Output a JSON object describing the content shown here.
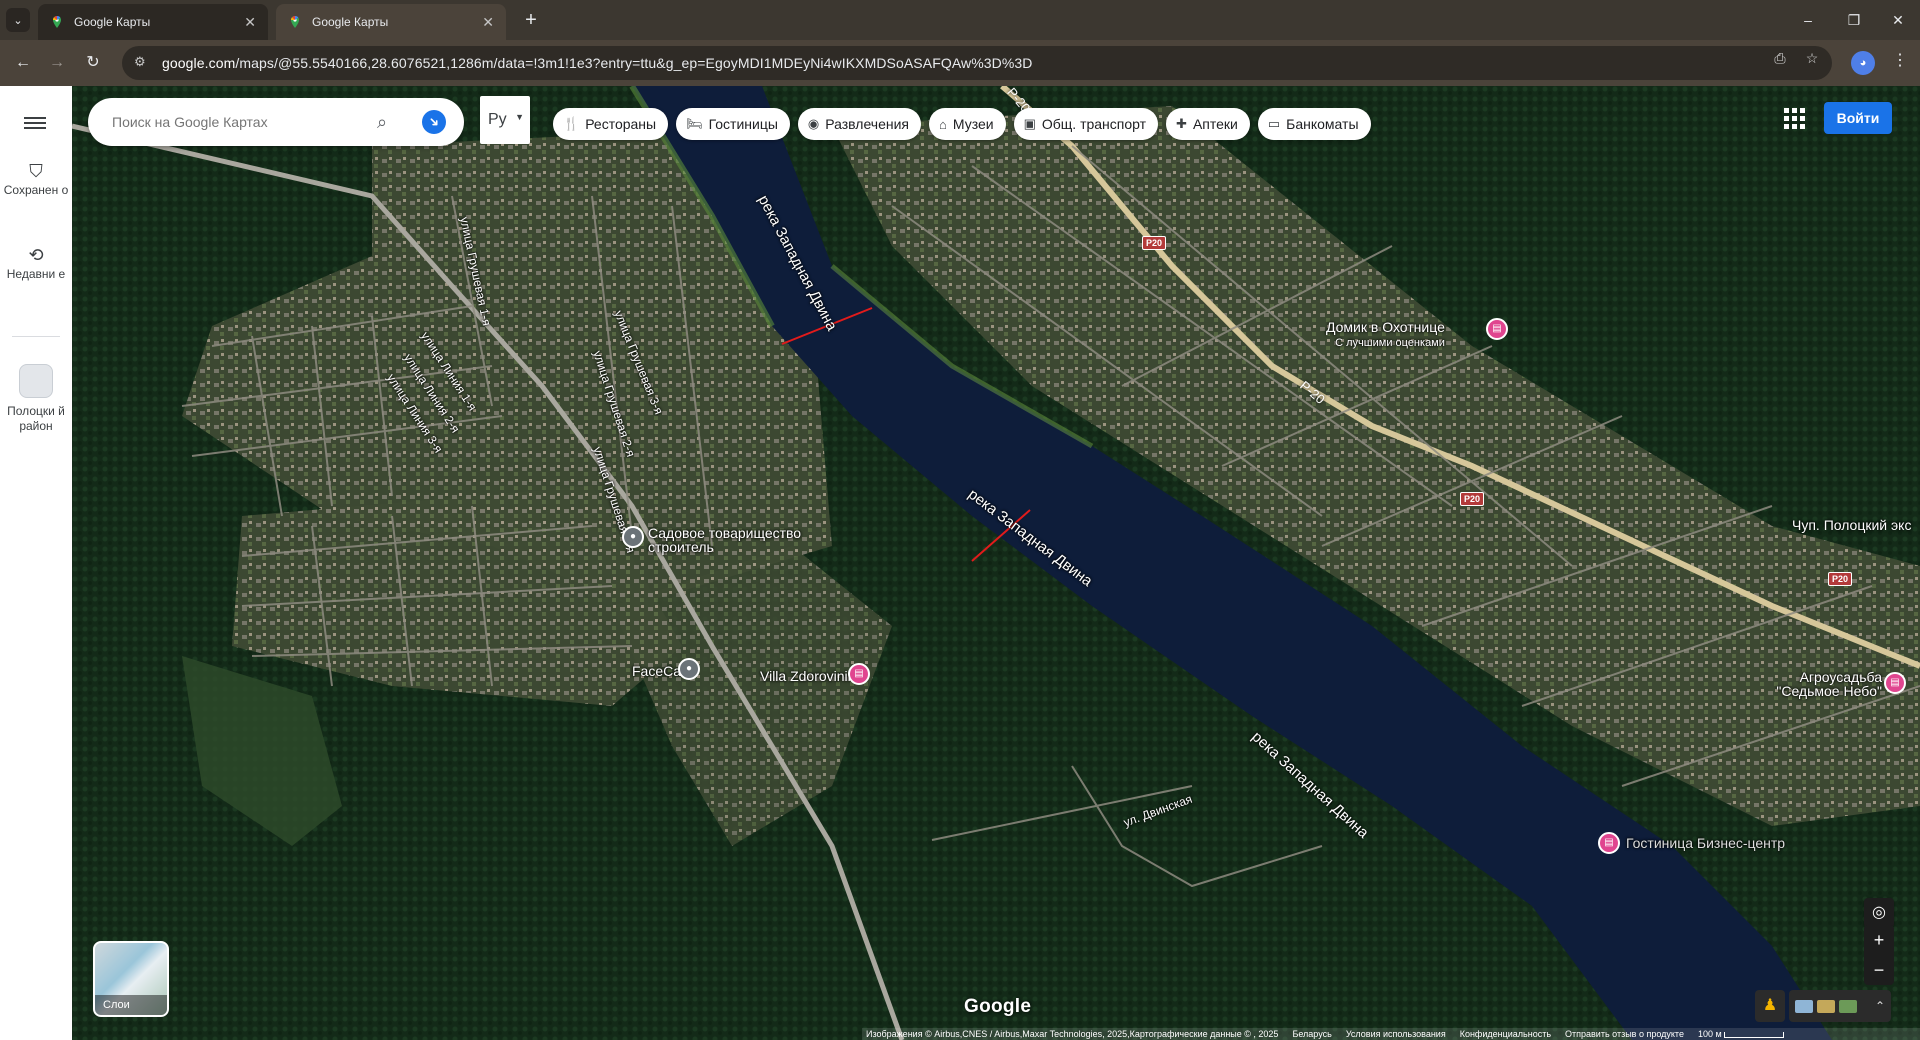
{
  "browser": {
    "tabs": [
      {
        "title": "Google Карты",
        "active": false
      },
      {
        "title": "Google Карты",
        "active": true
      }
    ],
    "new_tab": "+",
    "url_domain": "google.com",
    "url_path": "/maps/@55.5540166,28.6076521,1286m/data=!3m1!1e3?entry=ttu&g_ep=EgoyMDI1MDEyNi4wIKXMDSoASAFQAw%3D%3D",
    "window_controls": [
      "–",
      "❐",
      "✕"
    ]
  },
  "rail": {
    "menu_icon": "hamburger-icon",
    "items": [
      {
        "label": "Сохранен о",
        "icon": "bookmark-icon"
      },
      {
        "label": "Недавни е",
        "icon": "history-icon"
      },
      {
        "label": "Полоцки й район",
        "icon": "area-thumbnail"
      }
    ]
  },
  "search": {
    "placeholder": "Поиск на Google Картах",
    "value": ""
  },
  "language": {
    "selected": "Ру"
  },
  "chips": [
    {
      "label": "Рестораны",
      "icon": "restaurant-icon",
      "glyph": "🍴"
    },
    {
      "label": "Гостиницы",
      "icon": "hotel-icon",
      "glyph": "🛏"
    },
    {
      "label": "Развлечения",
      "icon": "camera-icon",
      "glyph": "◉"
    },
    {
      "label": "Музеи",
      "icon": "museum-icon",
      "glyph": "⌂"
    },
    {
      "label": "Общ. транспорт",
      "icon": "transit-icon",
      "glyph": "▣"
    },
    {
      "label": "Аптеки",
      "icon": "pharmacy-icon",
      "glyph": "✚"
    },
    {
      "label": "Банкоматы",
      "icon": "atm-icon",
      "glyph": "▭"
    }
  ],
  "signin_label": "Войти",
  "map": {
    "rivers": [
      "река Западная Двина",
      "река Западная Двина",
      "река Западная Двина"
    ],
    "roads": [
      "улица Грушевая 1-я",
      "улица Грушевая 3-я",
      "улица Грушевая 2-я",
      "улица Грушевая 1-я",
      "улица Линия 1-я",
      "улица Линия 2-я",
      "улица Линия 3-я",
      "ул. Двинская"
    ],
    "shields": [
      "P20",
      "P20",
      "P20"
    ],
    "highway_label": "P-20",
    "highway_label_top": "P-20",
    "pois": [
      {
        "name": "Домик в Охотнице",
        "sub": "С лучшими оценками",
        "pin": "pink"
      },
      {
        "name": "Садовое товарищество строитель",
        "sub": "",
        "pin": "gray"
      },
      {
        "name": "FaceCar",
        "sub": "",
        "pin": "gray"
      },
      {
        "name": "Villa Zdorovinina",
        "sub": "",
        "pin": "pink"
      },
      {
        "name": "Агроусадьба \"Седьмое Небо\"",
        "sub": "",
        "pin": "pink"
      },
      {
        "name": "Чуп. Полоцкий экс",
        "sub": "",
        "pin": ""
      },
      {
        "name": "Гостиница Бизнес-центр",
        "sub": "",
        "pin": "pink"
      }
    ]
  },
  "layers_label": "Слои",
  "google_logo": "Google",
  "footer": {
    "imagery": "Изображения © Airbus,CNES / Airbus,Maxar Technologies, 2025,Картографические данные © , 2025",
    "country": "Беларусь",
    "terms": "Условия использования",
    "privacy": "Конфиденциальность",
    "feedback": "Отправить отзыв о продукте",
    "scale": "100 м"
  },
  "colors": {
    "accent": "#1a73e8",
    "tab_bar": "#3c3730",
    "toolbar": "#4b433a",
    "river": "#0e1d3a",
    "forest": "#15301c",
    "poi_pink": "#e0458f"
  }
}
